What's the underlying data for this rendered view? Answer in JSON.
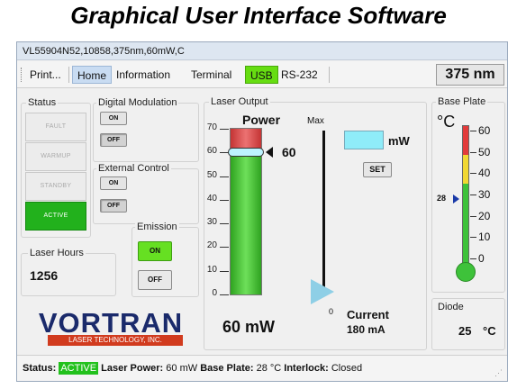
{
  "heading": "Graphical User Interface Software",
  "window": {
    "title": "VL55904N52,10858,375nm,60mW,C"
  },
  "menu": {
    "print": "Print...",
    "home": "Home",
    "information": "Information",
    "terminal": "Terminal",
    "usb": "USB",
    "rs232": "RS-232"
  },
  "wavelength": "375 nm",
  "status": {
    "title": "Status",
    "items": [
      "FAULT",
      "WARMUP",
      "STANDBY",
      "ACTIVE"
    ],
    "active_index": 3
  },
  "digital_modulation": {
    "title": "Digital Modulation",
    "on": "ON",
    "off": "OFF"
  },
  "external_control": {
    "title": "External Control",
    "on": "ON",
    "off": "OFF"
  },
  "emission": {
    "title": "Emission",
    "on": "ON",
    "off": "OFF"
  },
  "laser_hours": {
    "title": "Laser Hours",
    "value": "1256"
  },
  "logo": {
    "text": "VORTRAN",
    "tagline": "LASER TECHNOLOGY, INC."
  },
  "laser_output": {
    "title": "Laser Output",
    "power_label": "Power",
    "power_ticks": [
      "70",
      "60",
      "50",
      "40",
      "30",
      "20",
      "10",
      "0"
    ],
    "power_max": 70,
    "power_fill": 60,
    "setpoint_value": "60",
    "power_reading": "60 mW",
    "slider_max": "Max",
    "slider_min": "0",
    "current_label": "Current",
    "current_value": "180 mA",
    "unit": "mW",
    "set_button": "SET",
    "input_value": ""
  },
  "base_plate": {
    "title": "Base Plate",
    "unit": "°C",
    "ticks": [
      "60",
      "50",
      "40",
      "30",
      "20",
      "10",
      "0"
    ],
    "indicator": "28",
    "temp_value": 28
  },
  "diode": {
    "title": "Diode",
    "value": "25",
    "unit": "°C"
  },
  "statusbar": {
    "status_label": "Status:",
    "status_value": "ACTIVE",
    "power_label": "Laser Power:",
    "power_value": "60 mW",
    "base_label": "Base Plate:",
    "base_value": "28 °C",
    "interlock_label": "Interlock:",
    "interlock_value": "Closed"
  },
  "colors": {
    "active_green": "#22b11c",
    "usb_green": "#66dd11",
    "laser_fill": "#3cbf2e",
    "alarm_red": "#d94848",
    "title_blue": "#dde6f1"
  }
}
